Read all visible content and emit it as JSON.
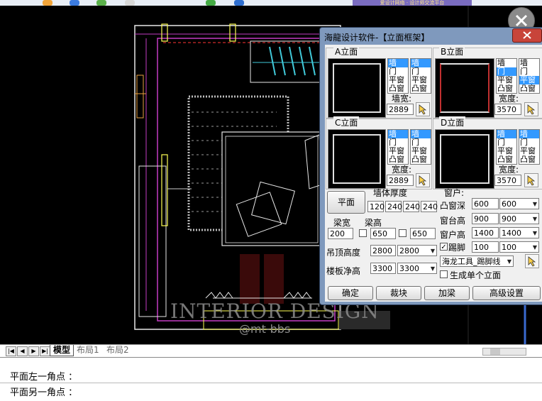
{
  "topbar": {
    "banner_text": "爱设计网络 · 设计师交流平台"
  },
  "dialog": {
    "title": "海龍设计软件-【立面框架】",
    "panels": {
      "a": {
        "title": "A立面",
        "width_label": "墙宽:",
        "width_value": "2889",
        "list1": [
          "墙",
          "门",
          "平窗",
          "凸窗"
        ],
        "list2": [
          "墙",
          "门",
          "平窗",
          "凸窗"
        ]
      },
      "b": {
        "title": "B立面",
        "width_label": "宽度:",
        "width_value": "3570",
        "list1": [
          "墙",
          "门",
          "平窗",
          "凸窗"
        ],
        "list2": [
          "墙",
          "门",
          "平窗",
          "凸窗"
        ]
      },
      "c": {
        "title": "C立面",
        "width_label": "宽度:",
        "width_value": "2889",
        "list1": [
          "墙",
          "门",
          "平窗",
          "凸窗"
        ],
        "list2": [
          "墙",
          "门",
          "平窗",
          "凸窗"
        ]
      },
      "d": {
        "title": "D立面",
        "width_label": "宽度:",
        "width_value": "3570",
        "list1": [
          "墙",
          "门",
          "平窗",
          "凸窗"
        ],
        "list2": [
          "墙",
          "门",
          "平窗",
          "凸窗"
        ]
      }
    },
    "plan_button": "平面",
    "wall_thickness_label": "墙体厚度",
    "wall_thickness": [
      "120",
      "240",
      "240",
      "240"
    ],
    "window_label": "窗户:",
    "bay_depth_label": "凸窗深",
    "bay_depth_value": "600",
    "bay_depth_select": "600",
    "sill_height_label": "窗台高",
    "sill_height_value": "900",
    "sill_height_select": "900",
    "window_height_label": "窗户高",
    "window_height_value": "1400",
    "window_height_select": "1400",
    "skirting_label": "踢脚",
    "skirting_value": "100",
    "skirting_select": "100",
    "beam_width_label": "梁宽",
    "beam_width_value": "200",
    "beam_height_label": "梁高",
    "beam_height_value1": "650",
    "beam_height_value2": "650",
    "ceiling_height_label": "吊顶高度",
    "ceiling_height_value": "2800",
    "ceiling_height_select": "2800",
    "floor_height_label": "楼板净高",
    "floor_height_value": "3300",
    "floor_height_select": "3300",
    "tool_select": "海龙工具_踢脚线",
    "single_elevation_label": "生成单个立面",
    "buttons": {
      "ok": "确定",
      "clip": "裁块",
      "beam": "加梁",
      "advanced": "高级设置"
    }
  },
  "watermark": {
    "main": "INTERIOR DESIGN",
    "sub": "@mt-bbs"
  },
  "layout_tabs": [
    "模型",
    "布局1",
    "布局2"
  ],
  "command_lines": [
    "平面左一角点 ：",
    "平面另一角点 ："
  ],
  "colors": {
    "dialog_frame": "#7f99bd",
    "cad_background": "#000000",
    "magenta_line": "#c43cc4",
    "selection": "#3399ff"
  }
}
